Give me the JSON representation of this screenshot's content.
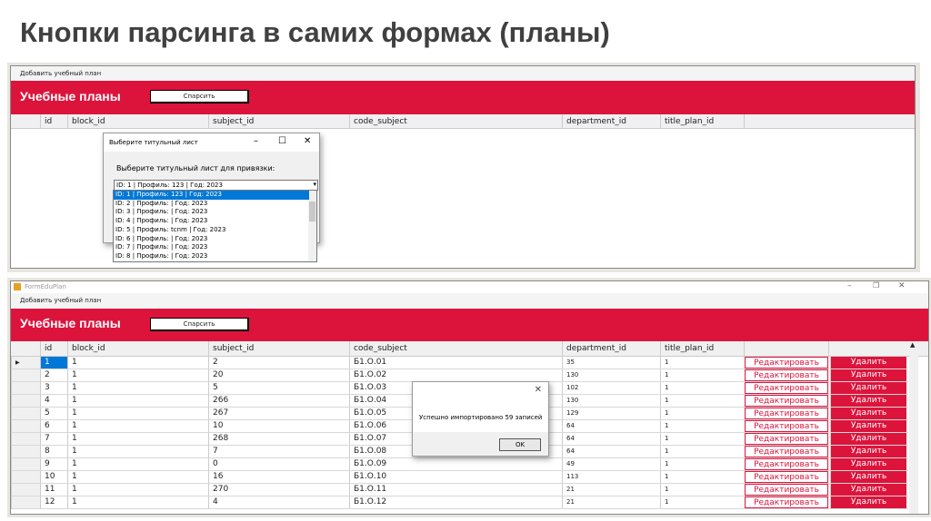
{
  "slide_title": "Кнопки парсинга в самих формах (планы)",
  "top_window": {
    "menu": "Добавить учебный план",
    "heading": "Учебные планы",
    "parse_button": "Спарсить",
    "columns": [
      "id",
      "block_id",
      "subject_id",
      "code_subject",
      "department_id",
      "title_plan_id"
    ],
    "dialog": {
      "title": "Выберите титульный лист",
      "prompt": "Выберите титульный лист для привязки:",
      "selected": "ID: 1 | Профиль: 123 | Год: 2023",
      "options": [
        "ID: 1 | Профиль: 123 | Год: 2023",
        "ID: 2 | Профиль:  | Год: 2023",
        "ID: 3 | Профиль:  | Год: 2023",
        "ID: 4 | Профиль:  | Год: 2023",
        "ID: 5 | Профиль: tcnm | Год: 2023",
        "ID: 6 | Профиль:  | Год: 2023",
        "ID: 7 | Профиль:  | Год: 2023",
        "ID: 8 | Профиль:  | Год: 2023"
      ]
    }
  },
  "bottom_window": {
    "title": "FormEduPlan",
    "menu": "Добавить учебный план",
    "heading": "Учебные планы",
    "parse_button": "Спарсить",
    "columns": [
      "id",
      "block_id",
      "subject_id",
      "code_subject",
      "department_id",
      "title_plan_id"
    ],
    "edit_label": "Редактировать",
    "delete_label": "Удалить",
    "rows": [
      [
        "1",
        "1",
        "2",
        "Б1.О.01",
        "35",
        "1"
      ],
      [
        "2",
        "1",
        "20",
        "Б1.О.02",
        "130",
        "1"
      ],
      [
        "3",
        "1",
        "5",
        "Б1.О.03",
        "102",
        "1"
      ],
      [
        "4",
        "1",
        "266",
        "Б1.О.04",
        "130",
        "1"
      ],
      [
        "5",
        "1",
        "267",
        "Б1.О.05",
        "129",
        "1"
      ],
      [
        "6",
        "1",
        "10",
        "Б1.О.06",
        "64",
        "1"
      ],
      [
        "7",
        "1",
        "268",
        "Б1.О.07",
        "64",
        "1"
      ],
      [
        "8",
        "1",
        "7",
        "Б1.О.08",
        "64",
        "1"
      ],
      [
        "9",
        "1",
        "0",
        "Б1.О.09",
        "49",
        "1"
      ],
      [
        "10",
        "1",
        "16",
        "Б1.О.10",
        "113",
        "1"
      ],
      [
        "11",
        "1",
        "270",
        "Б1.О.11",
        "21",
        "1"
      ],
      [
        "12",
        "1",
        "4",
        "Б1.О.12",
        "21",
        "1"
      ]
    ],
    "message": {
      "text": "Успешно импортировано 59 записей",
      "ok": "OK"
    }
  }
}
